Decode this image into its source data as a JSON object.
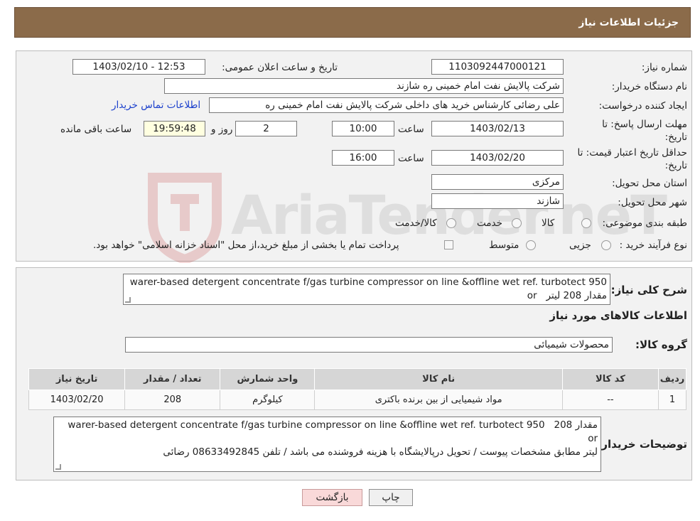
{
  "header": {
    "title": "جزئیات اطلاعات نیاز"
  },
  "form": {
    "need_number": {
      "label": "شماره نیاز:",
      "value": "1103092447000121"
    },
    "announce_datetime": {
      "label": "تاریخ و ساعت اعلان عمومی:",
      "value": "1403/02/10 - 12:53"
    },
    "buyer_org": {
      "label": "نام دستگاه خریدار:",
      "value": "شرکت پالایش نفت امام خمینی  ره  شازند"
    },
    "requester": {
      "label": "ایجاد کننده درخواست:",
      "value": "علی  رضائی کارشناس خرید های داخلی  شرکت پالایش نفت امام خمینی  ره",
      "contact_link": "اطلاعات تماس خریدار"
    },
    "reply_deadline": {
      "label_line1": "مهلت ارسال پاسخ: تا",
      "label_line2": "تاریخ:",
      "date": "1403/02/13",
      "time_label": "ساعت",
      "time": "10:00",
      "days": "2",
      "days_label": "روز و",
      "remaining": "19:59:48",
      "remaining_label": "ساعت باقی مانده"
    },
    "price_validity": {
      "label_line1": "حداقل تاریخ اعتبار قیمت: تا",
      "label_line2": "تاریخ:",
      "date": "1403/02/20",
      "time_label": "ساعت",
      "time": "16:00"
    },
    "delivery_province": {
      "label": "استان محل تحویل:",
      "value": "مرکزی"
    },
    "delivery_city": {
      "label": "شهر محل تحویل:",
      "value": "شازند"
    },
    "category": {
      "label": "طبقه بندی موضوعی:",
      "options": [
        "کالا",
        "خدمت",
        "کالا/خدمت"
      ]
    },
    "purchase_type": {
      "label": "نوع فرآیند خرید :",
      "options": [
        "جزیی",
        "متوسط"
      ],
      "note": "پرداخت تمام یا بخشی از مبلغ خرید،از محل \"اسناد خزانه اسلامی\" خواهد بود."
    }
  },
  "description": {
    "label": "شرح کلی نیاز:",
    "text_line1": "warer-based detergent  concentrate f/gas turbine  compressor on line &offline wet ref. turbotect 950",
    "text_line2_ltr": "or",
    "text_line2_rtl": "مقدار 208 لیتر"
  },
  "goods_section": {
    "title": "اطلاعات کالاهای مورد نیاز",
    "group_label": "گروه کالا:",
    "group_value": "محصولات شیمیائی"
  },
  "table": {
    "headers": [
      "ردیف",
      "کد کالا",
      "نام کالا",
      "واحد شمارش",
      "تعداد / مقدار",
      "تاریخ نیاز"
    ],
    "rows": [
      [
        "1",
        "--",
        "مواد شیمیایی از بین برنده باکتری",
        "کیلوگرم",
        "208",
        "1403/02/20"
      ]
    ]
  },
  "buyer_notes": {
    "label": "توضیحات خریدار:",
    "line1_ltr": "warer-based detergent  concentrate f/gas turbine  compressor on line &offline wet ref. turbotect 950 or",
    "line1_rtl": "مقدار 208",
    "line2": "لیتر مطابق مشخصات پیوست / تحویل درپالایشگاه با هزینه فروشنده می باشد  / تلفن 08633492845 رضائی"
  },
  "buttons": {
    "print": "چاپ",
    "back": "بازگشت"
  },
  "watermark": {
    "text": "AriaTender.neT"
  }
}
